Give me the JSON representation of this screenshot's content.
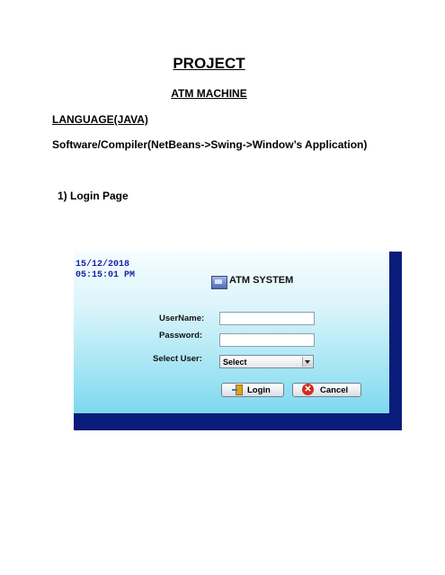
{
  "document": {
    "title": "PROJECT",
    "subtitle": "ATM MACHINE",
    "language": "LANGUAGE(JAVA)",
    "software": "Software/Compiler(NetBeans->Swing->Window’s Application)",
    "section": "1) Login Page"
  },
  "app": {
    "date": "15/12/2018",
    "time": "05:15:01 PM",
    "title": "ATM SYSTEM",
    "logo_icon": "atm-monitor-icon",
    "username_label": "UserName:",
    "username_value": "",
    "password_label": "Password:",
    "password_value": "",
    "select_user_label": "Select User:",
    "select_user_value": "Select",
    "login_label": "Login",
    "login_icon": "login-door-icon",
    "cancel_label": "Cancel",
    "cancel_icon": "cancel-x-icon",
    "colors": {
      "border_bar": "#0a1c7a",
      "clock_text": "#1b22a8",
      "background_gradient": [
        "#f6fdff",
        "#6fd2ec"
      ]
    }
  }
}
